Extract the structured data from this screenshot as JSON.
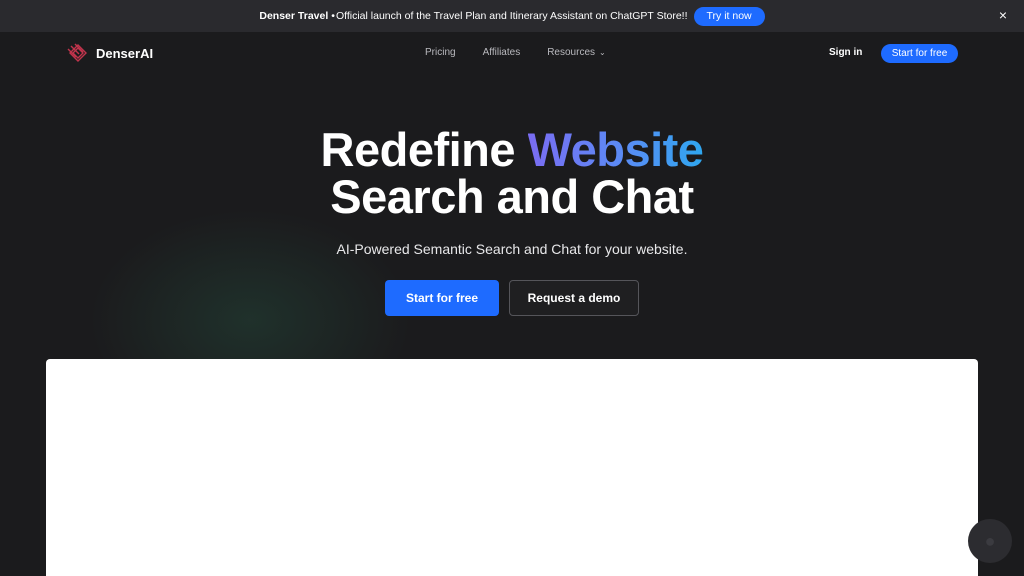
{
  "announcement": {
    "brand": "Denser Travel",
    "separator": "•",
    "message": "Official launch of the Travel Plan and Itinerary Assistant on ChatGPT Store!!",
    "cta_label": "Try it now",
    "close_icon": "×"
  },
  "header": {
    "brand": "DenserAI",
    "nav": [
      {
        "label": "Pricing"
      },
      {
        "label": "Affiliates"
      },
      {
        "label": "Resources"
      }
    ],
    "resources_chevron": "⌄",
    "signin_label": "Sign in",
    "start_label": "Start for free"
  },
  "hero": {
    "title_part1": "Redefine ",
    "title_accent": "Website",
    "title_line2": "Search and Chat",
    "subtitle": "AI-Powered Semantic Search and Chat for your website.",
    "primary_cta": "Start for free",
    "secondary_cta": "Request a demo"
  },
  "colors": {
    "accent_blue": "#1e6bff",
    "background": "#1b1b1d",
    "gradient_start": "#7a6cf2",
    "gradient_end": "#2fa7f0"
  },
  "icons": {
    "logo": "denserai-logo-icon",
    "close": "close-icon",
    "chevron": "chevron-down-icon",
    "chat": "chat-bubble-icon"
  }
}
